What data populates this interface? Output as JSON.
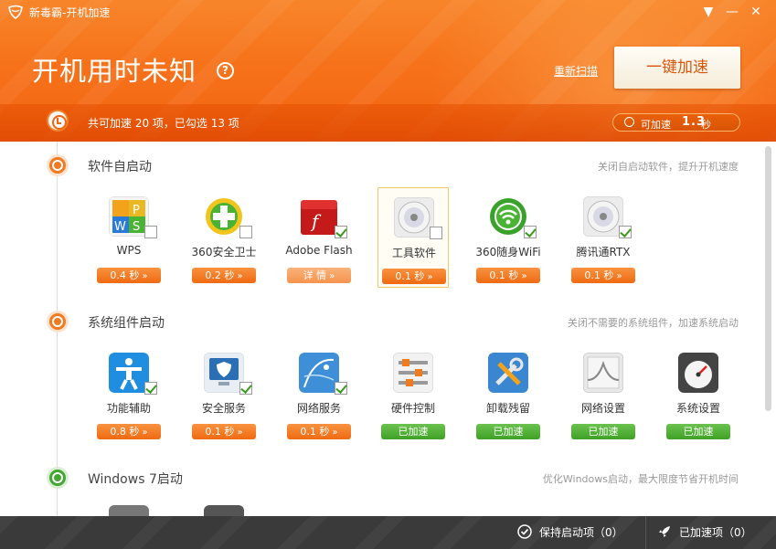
{
  "window": {
    "title": "新毒霸-开机加速",
    "menu_glyph": "▼",
    "min_glyph": "—",
    "close_glyph": "✕"
  },
  "header": {
    "main_title": "开机用时未知",
    "help_glyph": "?",
    "rescan_label": "重新扫描",
    "accelerate_label": "一键加速",
    "summary_text": "共可加速 20 项，已勾选 13 项",
    "saveable_label": "可加速",
    "saveable_value": "1.3",
    "saveable_unit": "秒"
  },
  "sections": [
    {
      "title": "软件自启动",
      "desc": "关闭自启动软件，提升开机速度",
      "items": [
        {
          "label": "WPS",
          "pill": "0.4 秒",
          "checked": false,
          "icon": "wps-icon"
        },
        {
          "label": "360安全卫士",
          "pill": "0.2 秒",
          "checked": false,
          "icon": "360-safe-icon"
        },
        {
          "label": "Adobe Flash",
          "pill": "详 情",
          "checked": true,
          "icon": "adobe-flash-icon"
        },
        {
          "label": "工具软件",
          "pill": "0.1 秒",
          "checked": false,
          "icon": "disc-icon"
        },
        {
          "label": "360随身WiFi",
          "pill": "0.1 秒",
          "checked": true,
          "icon": "wifi-icon"
        },
        {
          "label": "腾讯通RTX",
          "pill": "0.1 秒",
          "checked": true,
          "icon": "disc-icon"
        }
      ]
    },
    {
      "title": "系统组件启动",
      "desc": "关闭不需要的系统组件，加速系统启动",
      "items": [
        {
          "label": "功能辅助",
          "pill": "0.8 秒",
          "checked": true,
          "icon": "accessibility-icon"
        },
        {
          "label": "安全服务",
          "pill": "0.1 秒",
          "checked": true,
          "icon": "security-monitor-icon"
        },
        {
          "label": "网络服务",
          "pill": "0.1 秒",
          "checked": true,
          "icon": "network-icon"
        },
        {
          "label": "硬件控制",
          "pill": "已加速",
          "checked": false,
          "icon": "sliders-icon"
        },
        {
          "label": "卸载残留",
          "pill": "已加速",
          "checked": false,
          "icon": "tools-icon"
        },
        {
          "label": "网络设置",
          "pill": "已加速",
          "checked": false,
          "icon": "chart-icon"
        },
        {
          "label": "系统设置",
          "pill": "已加速",
          "checked": false,
          "icon": "gauge-icon"
        }
      ]
    },
    {
      "title": "Windows 7启动",
      "desc": "优化Windows启动，最大限度节省开机时间",
      "items": []
    }
  ],
  "footer": {
    "keep_label": "保持启动项（0）",
    "done_label": "已加速项（0）"
  },
  "colors": {
    "brand_orange": "#f36c16",
    "accent_green": "#43a731",
    "accelerate_text": "#d9570c"
  }
}
